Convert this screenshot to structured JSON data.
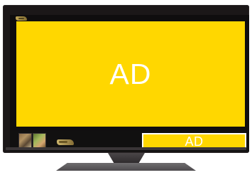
{
  "screen": {
    "top_logo_icon": "gold-logo-icon",
    "main_ad": {
      "label": "AD",
      "background_color": "#ffd700",
      "text_color": "#ffffff"
    },
    "bottom_bar": {
      "thumbnails": [
        {
          "icon": "thumbnail-image-1"
        },
        {
          "icon": "thumbnail-image-2"
        }
      ],
      "logo_icon": "gold-logo-icon",
      "small_ad": {
        "label": "AD",
        "background_color": "#ffd700",
        "text_color": "#ffffff"
      }
    }
  },
  "tv": {
    "frame_color": "#1b1718",
    "stand_color": "#5b585b"
  }
}
